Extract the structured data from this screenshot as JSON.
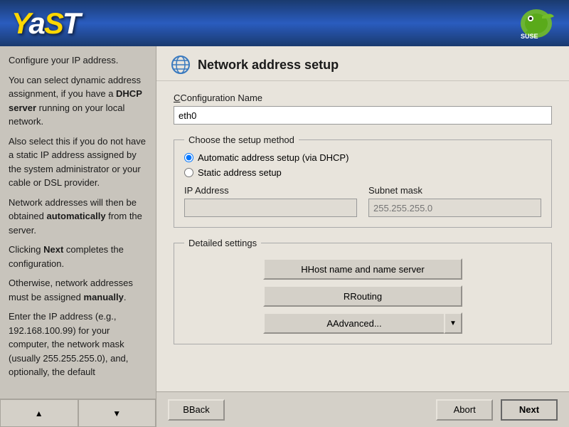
{
  "header": {
    "title": "YaST",
    "logo_letters": {
      "y": "Y",
      "a": "a",
      "s": "S",
      "t": "T"
    }
  },
  "sidebar": {
    "paragraphs": [
      "Configure your IP address.",
      "You can select dynamic address assignment, if you have a <strong>DHCP server</strong> running on your local network.",
      "Also select this if you do not have a static IP address assigned by the system administrator or your cable or DSL provider.",
      "Network addresses will then be obtained <strong>automatically</strong> from the server.",
      "Clicking <strong>Next</strong> completes the configuration.",
      "Otherwise, network addresses must be assigned <strong>manually</strong>.",
      "Enter the IP address (e.g., 192.168.100.99) for your computer, the network mask (usually 255.255.255.0), and, optionally, the default"
    ],
    "nav_up": "▲",
    "nav_down": "▼"
  },
  "panel": {
    "title": "Network address setup",
    "config_name_label": "Configuration Name",
    "config_name_value": "eth0",
    "setup_method_legend": "Choose the setup method",
    "radio_dhcp_label": "Automatic address setup (via DHCP)",
    "radio_static_label": "Static address setup",
    "ip_address_label": "IP Address",
    "ip_address_value": "",
    "ip_address_placeholder": "",
    "subnet_mask_label": "Subnet mask",
    "subnet_mask_placeholder": "255.255.255.0",
    "detailed_legend": "Detailed settings",
    "host_name_btn": "Host name and name server",
    "routing_btn": "Routing",
    "advanced_btn": "Advanced...",
    "dropdown_arrow": "▼"
  },
  "bottom_bar": {
    "back_label": "Back",
    "abort_label": "Abort",
    "next_label": "Next"
  }
}
